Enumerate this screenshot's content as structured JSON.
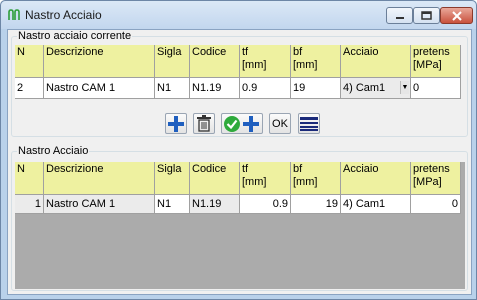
{
  "window": {
    "title": "Nastro Acciaio"
  },
  "top_group": {
    "title": "Nastro acciaio corrente"
  },
  "bottom_group": {
    "title": "Nastro Acciaio"
  },
  "columns": [
    {
      "line1": "N",
      "line2": ""
    },
    {
      "line1": "Descrizione",
      "line2": ""
    },
    {
      "line1": "Sigla",
      "line2": ""
    },
    {
      "line1": "Codice",
      "line2": ""
    },
    {
      "line1": "tf",
      "line2": "[mm]"
    },
    {
      "line1": "bf",
      "line2": "[mm]"
    },
    {
      "line1": "Acciaio",
      "line2": ""
    },
    {
      "line1": "pretens",
      "line2": "[MPa]"
    }
  ],
  "current_row": {
    "n": "2",
    "descrizione": "Nastro CAM 1",
    "sigla": "N1",
    "codice": "N1.19",
    "tf": "0.9",
    "bf": "19",
    "acciaio": "4) Cam1",
    "pretens": "0"
  },
  "toolbar": {
    "add_icon": "plus-icon",
    "delete_icon": "trash-icon",
    "confirm_add_icon": "check-plus-icon",
    "ok_label": "OK",
    "list_icon": "list-lines-icon"
  },
  "rows": [
    {
      "n": "1",
      "descrizione": "Nastro CAM 1",
      "sigla": "N1",
      "codice": "N1.19",
      "tf": "0.9",
      "bf": "19",
      "acciaio": "4) Cam1",
      "pretens": "0"
    }
  ],
  "colors": {
    "header": "#eef1a0",
    "title_bg": "#c9dcf1",
    "close_btn": "#c9513d"
  }
}
